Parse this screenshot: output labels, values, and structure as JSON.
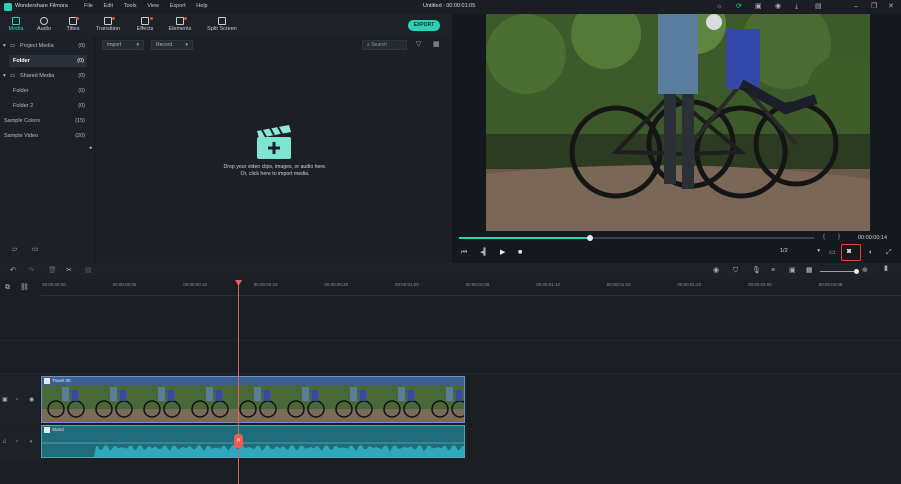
{
  "app": {
    "name": "Wondershare Filmora",
    "title": "Untitled : 00:00:01:05"
  },
  "menu": [
    "File",
    "Edit",
    "Tools",
    "View",
    "Export",
    "Help"
  ],
  "tabs": [
    {
      "label": "Media",
      "active": true,
      "badge": false
    },
    {
      "label": "Audio",
      "active": false,
      "badge": false
    },
    {
      "label": "Titles",
      "active": false,
      "badge": true
    },
    {
      "label": "Transition",
      "active": false,
      "badge": true
    },
    {
      "label": "Effects",
      "active": false,
      "badge": true
    },
    {
      "label": "Elements",
      "active": false,
      "badge": true
    },
    {
      "label": "Split Screen",
      "active": false,
      "badge": false
    }
  ],
  "export_label": "EXPORT",
  "sidebar": {
    "items": [
      {
        "label": "Project Media",
        "count": "(0)",
        "selected": false
      },
      {
        "label": "Folder",
        "count": "(0)",
        "selected": true
      },
      {
        "label": "Shared Media",
        "count": "(0)",
        "selected": false
      },
      {
        "label": "Folder",
        "count": "(0)",
        "selected": false
      },
      {
        "label": "Folder 2",
        "count": "(0)",
        "selected": false
      },
      {
        "label": "Sample Colors",
        "count": "(15)",
        "selected": false
      },
      {
        "label": "Sample Video",
        "count": "(20)",
        "selected": false
      }
    ]
  },
  "media": {
    "import_label": "Import",
    "record_label": "Record",
    "search_placeholder": "Search",
    "drop_line1": "Drop your video clips, images, or audio here.",
    "drop_line2": "Or, click here to import media."
  },
  "player": {
    "timecode": "00:00:00:14",
    "quality": "1/2",
    "progress": 0.37,
    "bracket_left": "{",
    "bracket_right": "}"
  },
  "timeline": {
    "ruler": [
      "00:00:00:00",
      "00:00:00:05",
      "00:00:00:10",
      "00:00:00:15",
      "00:00:00:20",
      "00:00:01:00",
      "00:00:01:05",
      "00:00:01:10",
      "00:00:01:15",
      "00:00:01:20",
      "00:00:02:00",
      "00:00:02:05"
    ],
    "video_clip_label": "Travel 05",
    "audio_clip_label": "Stand",
    "playhead_time": "00:00:00:14"
  },
  "colors": {
    "accent": "#2fd1b6",
    "playhead": "#ee5b52",
    "video_clip": "#3a5b8c",
    "audio_clip": "#2a8a9b"
  }
}
